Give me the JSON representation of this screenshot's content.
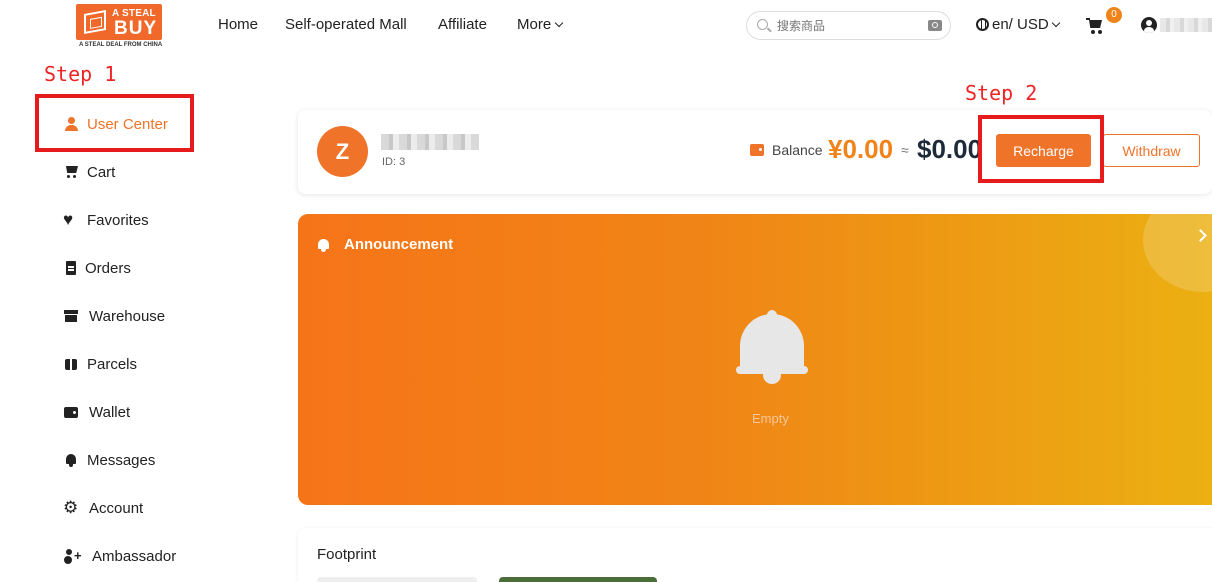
{
  "header": {
    "logo": {
      "small": "A STEAL",
      "big": "BUY",
      "tagline": "A STEAL DEAL FROM CHINA"
    },
    "nav": [
      {
        "label": "Home"
      },
      {
        "label": "Self-operated Mall"
      },
      {
        "label": "Affiliate"
      },
      {
        "label": "More"
      }
    ],
    "search": {
      "placeholder": "搜索商品"
    },
    "language": "en/ USD",
    "cart_count": "0"
  },
  "annotations": {
    "step1": "Step 1",
    "step2": "Step 2"
  },
  "sidebar": {
    "items": [
      {
        "label": "User Center",
        "icon": "user-icon",
        "active": true
      },
      {
        "label": "Cart",
        "icon": "cart-icon"
      },
      {
        "label": "Favorites",
        "icon": "heart-icon"
      },
      {
        "label": "Orders",
        "icon": "document-icon"
      },
      {
        "label": "Warehouse",
        "icon": "box-icon"
      },
      {
        "label": "Parcels",
        "icon": "parcel-icon"
      },
      {
        "label": "Wallet",
        "icon": "wallet-icon"
      },
      {
        "label": "Messages",
        "icon": "bell-icon"
      },
      {
        "label": "Account",
        "icon": "gear-icon"
      },
      {
        "label": "Ambassador",
        "icon": "add-user-icon"
      }
    ]
  },
  "profile": {
    "avatar_letter": "Z",
    "id_text": "ID: 3",
    "balance_label": "Balance",
    "balance_cny": "¥0.00",
    "approx": "≈",
    "balance_usd": "$0.00",
    "recharge_label": "Recharge",
    "withdraw_label": "Withdraw"
  },
  "announcement": {
    "title": "Announcement",
    "empty_text": "Empty"
  },
  "footprint": {
    "title": "Footprint"
  },
  "colors": {
    "accent": "#f0732a",
    "highlight": "#e61c1c",
    "badge": "#f0841a"
  }
}
